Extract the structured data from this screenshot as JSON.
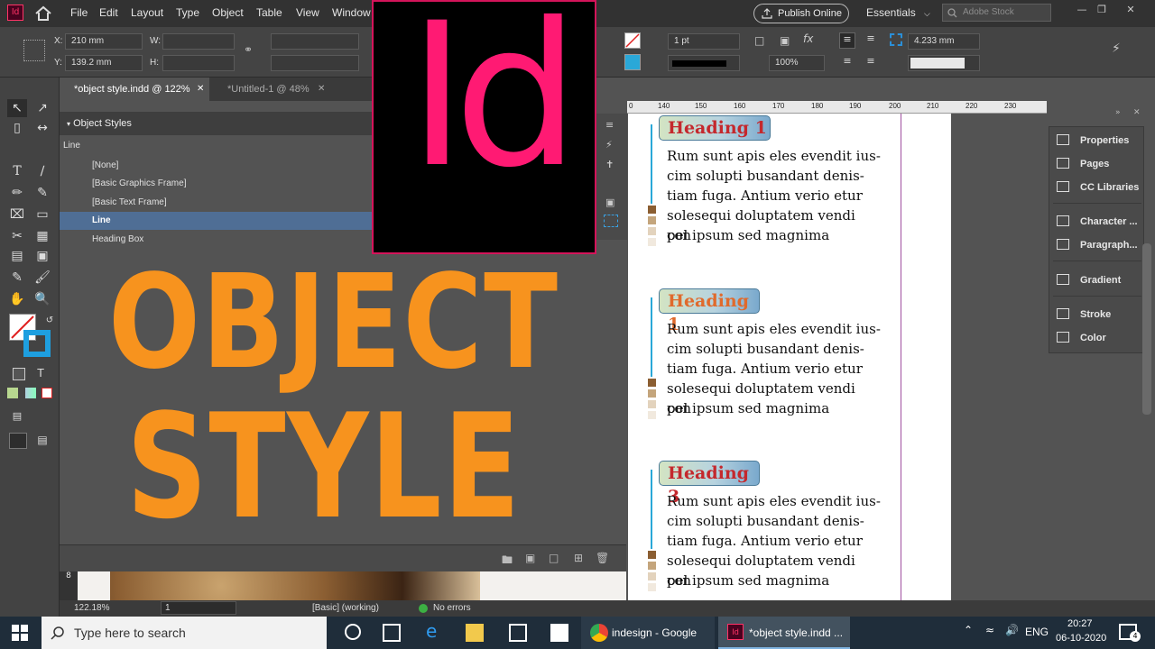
{
  "menubar": {
    "items": [
      "File",
      "Edit",
      "Layout",
      "Type",
      "Object",
      "Table",
      "View",
      "Window"
    ],
    "publish_label": "Publish Online",
    "workspace_label": "Essentials",
    "search_placeholder": "Adobe Stock"
  },
  "control": {
    "x_label": "X:",
    "x_value": "210 mm",
    "y_label": "Y:",
    "y_value": "139.2 mm",
    "w_label": "W:",
    "h_label": "H:",
    "stroke_weight": "1 pt",
    "scale": "100%",
    "dimension": "4.233 mm"
  },
  "tabs": [
    {
      "label": "*object style.indd @ 122%",
      "active": true
    },
    {
      "label": "*Untitled-1 @ 48%",
      "active": false
    }
  ],
  "object_styles": {
    "title": "Object Styles",
    "current": "Line",
    "rows": [
      {
        "label": "[None]",
        "selected": false
      },
      {
        "label": "[Basic Graphics Frame]",
        "selected": false
      },
      {
        "label": "[Basic Text Frame]",
        "selected": false
      },
      {
        "label": "Line",
        "selected": true
      },
      {
        "label": "Heading Box",
        "selected": false
      }
    ]
  },
  "logo": {
    "text": "Id"
  },
  "overlay": {
    "line1": "OBJECT",
    "line2": "STYLE"
  },
  "ruler": {
    "ticks": [
      "0",
      "140",
      "150",
      "160",
      "170",
      "180",
      "190",
      "200",
      "210",
      "220",
      "230"
    ]
  },
  "document": {
    "blocks": [
      {
        "heading": "Heading 1",
        "heading_color": "#c4282d",
        "lines": [
          "Rum sunt apis eles evendit ius-",
          "cim solupti busandant denis-",
          "tiam fuga. Antium verio etur",
          "solesequi doluptatem vendi con",
          "pel ipsum sed magnima"
        ]
      },
      {
        "heading": "Heading 1",
        "heading_color": "#e06a2c",
        "lines": [
          "Rum sunt apis eles evendit ius-",
          "cim solupti busandant denis-",
          "tiam fuga. Antium verio etur",
          "solesequi doluptatem vendi con",
          "pel ipsum sed magnima"
        ]
      },
      {
        "heading": "Heading 3",
        "heading_color": "#c4282d",
        "lines": [
          "Rum sunt apis eles evendit ius-",
          "cim solupti busandant denis-",
          "tiam fuga. Antium verio etur",
          "solesequi doluptatem vendi con",
          "pel ipsum sed magnima"
        ]
      }
    ]
  },
  "right_panel": {
    "items": [
      {
        "label": "Properties",
        "icon": "properties-icon"
      },
      {
        "label": "Pages",
        "icon": "pages-icon"
      },
      {
        "label": "CC Libraries",
        "icon": "cc-libraries-icon"
      },
      {
        "label": "Character ...",
        "icon": "character-icon"
      },
      {
        "label": "Paragraph...",
        "icon": "paragraph-icon"
      },
      {
        "label": "Gradient",
        "icon": "gradient-icon"
      },
      {
        "label": "Stroke",
        "icon": "stroke-icon"
      },
      {
        "label": "Color",
        "icon": "color-icon"
      }
    ]
  },
  "status": {
    "zoom": "122.18%",
    "page": "1",
    "style": "[Basic] (working)",
    "errors": "No errors",
    "vertical_ruler": "8"
  },
  "taskbar": {
    "search_placeholder": "Type here to search",
    "apps": [
      {
        "label": "indesign - Google S..."
      },
      {
        "label": "*object style.indd ..."
      }
    ],
    "lang": "ENG",
    "time": "20:27",
    "date": "06-10-2020",
    "notifications": "4"
  },
  "colors": {
    "accent_pink": "#ff1a73",
    "overlay_orange": "#f7931e",
    "heading_red": "#c4282d",
    "heading_orange": "#e06a2c",
    "selected_row": "#4f6e95"
  }
}
